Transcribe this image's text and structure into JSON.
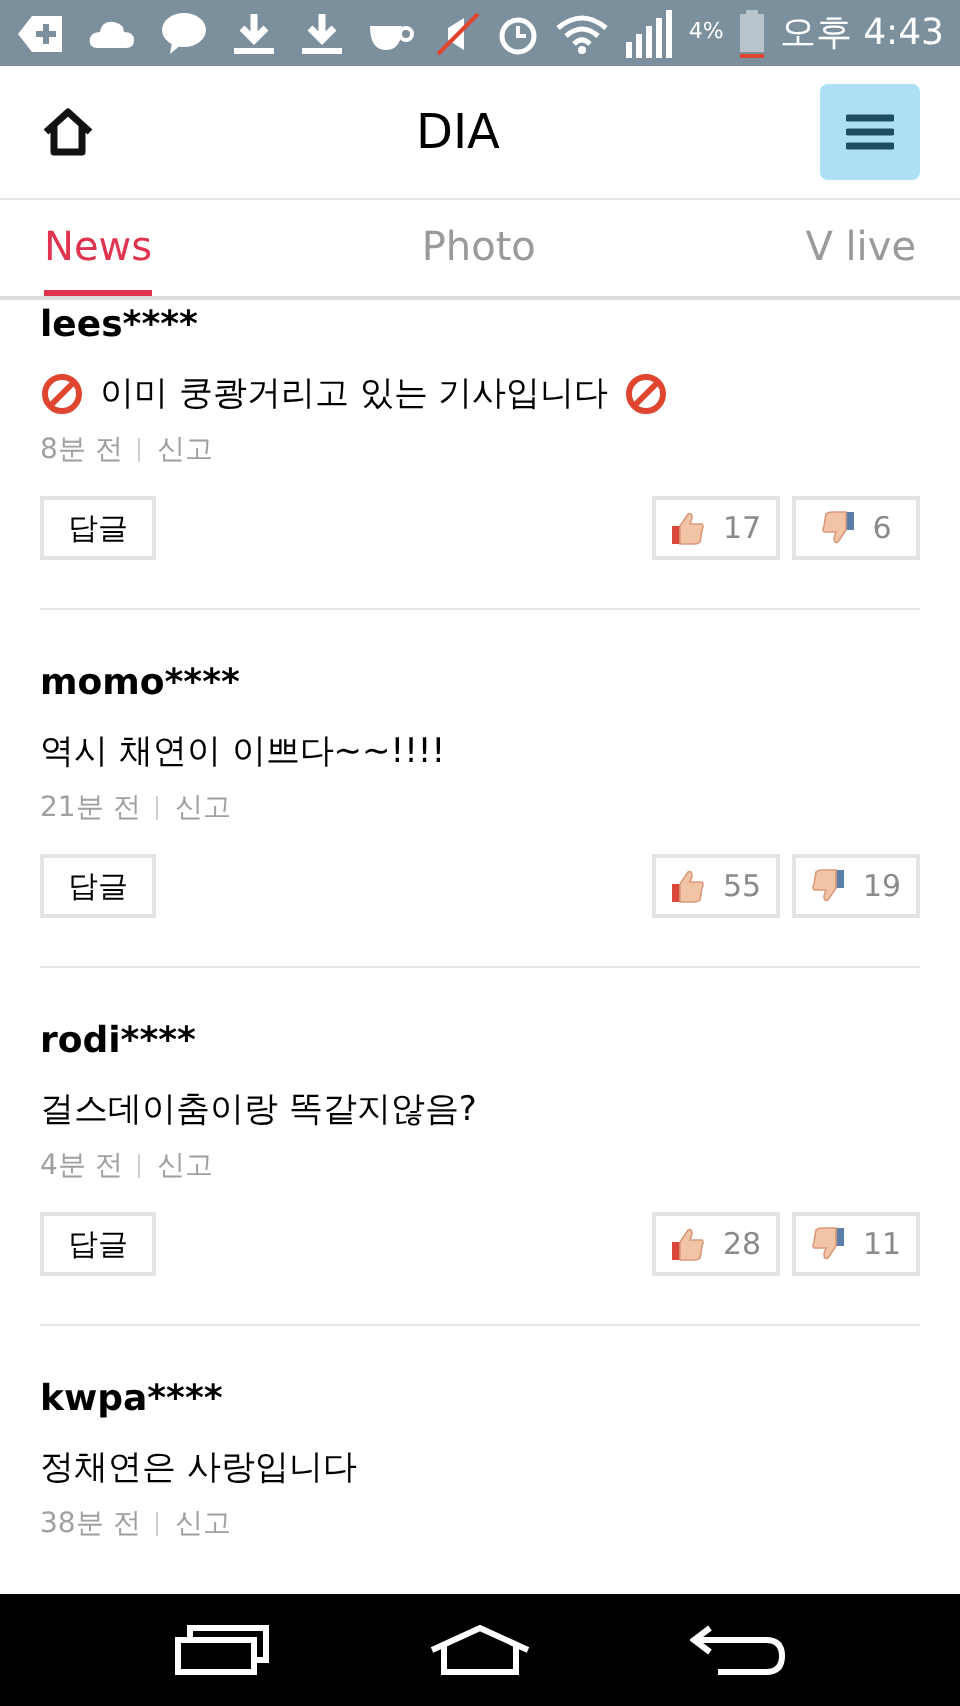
{
  "status_bar": {
    "battery_text": "4%",
    "time": "오후 4:43"
  },
  "header": {
    "title": "DIA"
  },
  "tabs": [
    {
      "label": "News",
      "selected": true
    },
    {
      "label": "Photo",
      "selected": false
    },
    {
      "label": "V live",
      "selected": false
    }
  ],
  "comments": [
    {
      "user": "lees****",
      "text": "이미 쿵쾅거리고 있는 기사입니다",
      "prohibited_marks": true,
      "time": "8분 전",
      "report": "신고",
      "reply": "답글",
      "likes": "17",
      "dislikes": "6"
    },
    {
      "user": "momo****",
      "text": "역시 채연이 이쁘다~~!!!!",
      "prohibited_marks": false,
      "time": "21분 전",
      "report": "신고",
      "reply": "답글",
      "likes": "55",
      "dislikes": "19"
    },
    {
      "user": "rodi****",
      "text": "걸스데이춤이랑 똑같지않음?",
      "prohibited_marks": false,
      "time": "4분 전",
      "report": "신고",
      "reply": "답글",
      "likes": "28",
      "dislikes": "11"
    },
    {
      "user": "kwpa****",
      "text": "정채연은 사랑입니다",
      "prohibited_marks": false,
      "time": "38분 전",
      "report": "신고"
    }
  ]
}
